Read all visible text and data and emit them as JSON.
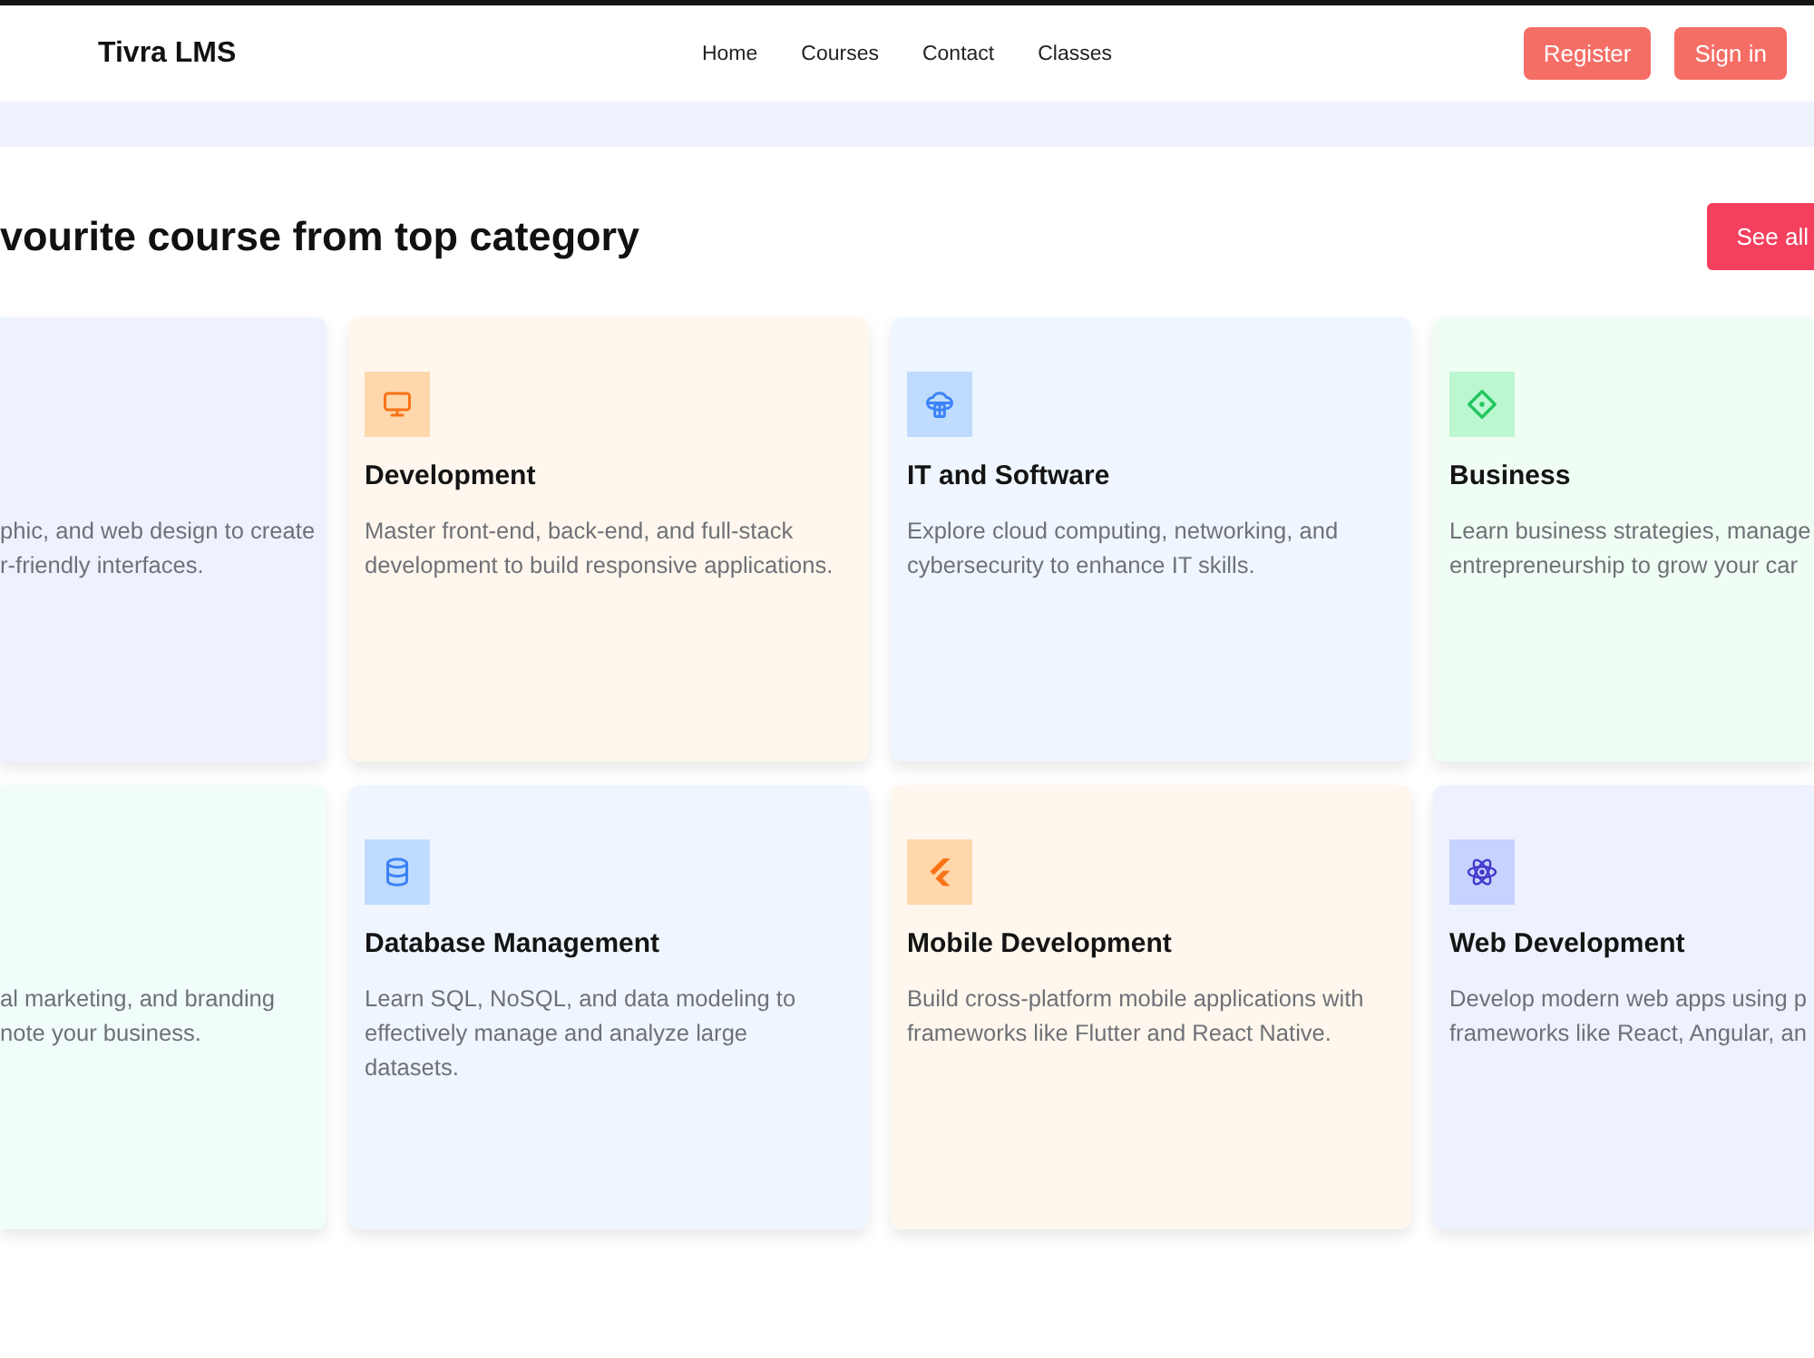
{
  "navbar": {
    "logo": "Tivra LMS",
    "links": [
      {
        "label": "Home"
      },
      {
        "label": "Courses"
      },
      {
        "label": "Contact"
      },
      {
        "label": "Classes"
      }
    ],
    "buttons": [
      {
        "label": "Register"
      },
      {
        "label": "Sign in"
      }
    ]
  },
  "section": {
    "heading": "vourite course from top category",
    "button": "See all"
  },
  "categories": [
    {
      "kind": "clipped_left",
      "color": "#eef2ff",
      "lines": [
        "phic, and web design to create",
        "r-friendly interfaces."
      ]
    },
    {
      "kind": "full",
      "color": "#fff7ed",
      "title": "Development",
      "description": "Master front-end, back-end, and full-stack development to build responsive applications."
    },
    {
      "kind": "full",
      "color": "#eff6ff",
      "title": "IT and Software",
      "description": "Explore cloud computing, networking, and cybersecurity to enhance IT skills."
    },
    {
      "kind": "clipped_right",
      "color": "#f0fdf4",
      "title": "Business",
      "lines": [
        "Learn business strategies, manage",
        "entrepreneurship to grow your car"
      ]
    },
    {
      "kind": "clipped_left",
      "color": "#f0fdfa",
      "lines": [
        "al marketing, and branding",
        "note your business."
      ]
    },
    {
      "kind": "full",
      "color": "#eff6ff",
      "title": "Database Management",
      "description": "Learn SQL, NoSQL, and data modeling to effectively manage and analyze large datasets."
    },
    {
      "kind": "full",
      "color": "#fff7ed",
      "title": "Mobile Development",
      "description": "Build cross-platform mobile applications with frameworks like Flutter and React Native."
    },
    {
      "kind": "clipped_right",
      "color": "#eef2ff",
      "title": "Web Development",
      "lines": [
        "Develop modern web apps using p",
        "frameworks like React, Angular, an"
      ]
    }
  ]
}
